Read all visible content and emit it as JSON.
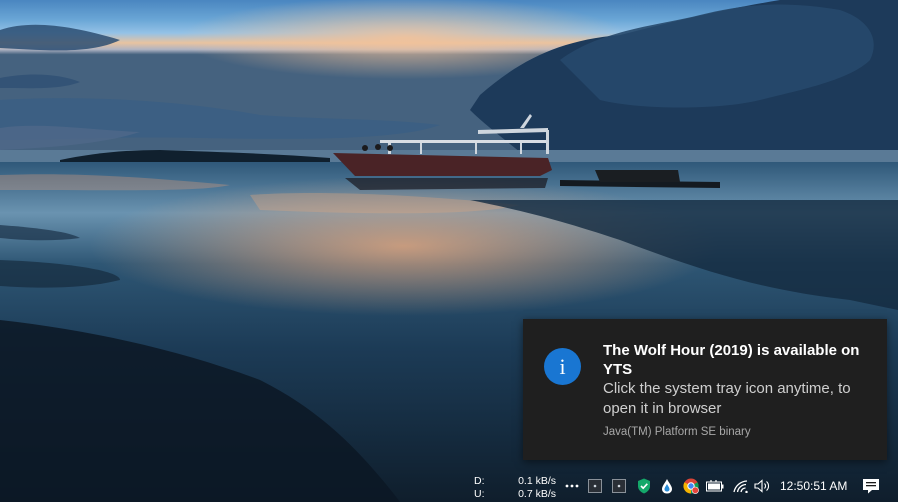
{
  "notification": {
    "title": "The Wolf Hour (2019) is available on YTS",
    "body": "Click the system tray icon anytime, to open it in browser",
    "attribution": "Java(TM) Platform SE binary",
    "icon": "info-icon",
    "icon_glyph": "i",
    "accent_color": "#1976d2"
  },
  "network_meter": {
    "download_label": "D:",
    "download_value": "0.1 kB/s",
    "upload_label": "U:",
    "upload_value": "0.7 kB/s"
  },
  "tray": {
    "icons": [
      "more-options-icon",
      "tray-app-icon",
      "tray-app-icon",
      "shield-check-icon",
      "water-drop-icon",
      "chrome-icon",
      "battery-icon",
      "wifi-icon",
      "volume-icon"
    ],
    "clock": "12:50:51 AM",
    "action_center_icon": "notification-icon"
  }
}
